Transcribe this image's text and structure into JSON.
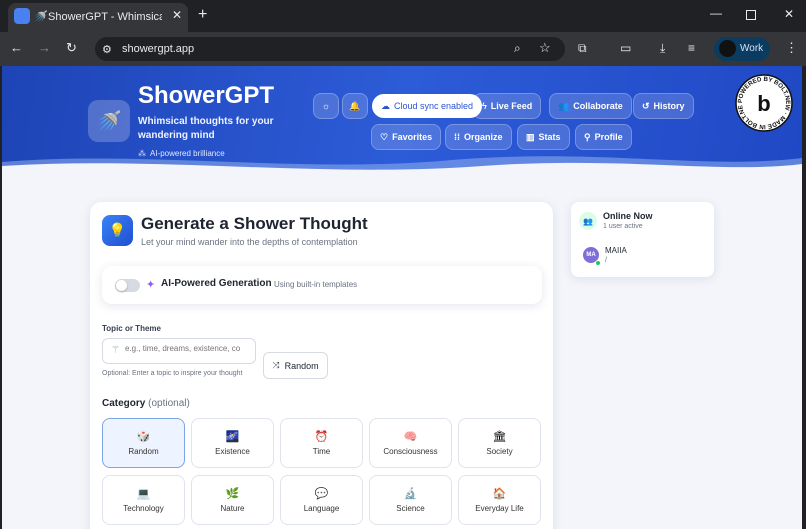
{
  "browser": {
    "tab_title": "ShowerGPT - Whimsical Sh",
    "url": "showergpt.app",
    "profile_label": "Work"
  },
  "header": {
    "app_name": "ShowerGPT",
    "tagline_line1": "Whimsical thoughts for your",
    "tagline_line2": "wandering mind",
    "badge": "AI-powered brilliance",
    "cloud_sync": "Cloud sync enabled",
    "nav": {
      "live_feed": "Live Feed",
      "collaborate": "Collaborate",
      "history": "History",
      "favorites": "Favorites",
      "organize": "Organize",
      "stats": "Stats",
      "profile": "Profile"
    },
    "bolt_badge_text": "POWERED BY BOLT.NEW · MADE IN BOLT.NEW ·"
  },
  "generator": {
    "title": "Generate a Shower Thought",
    "subtitle": "Let your mind wander into the depths of contemplation",
    "ai_label": "AI-Powered Generation",
    "ai_note": "Using built-in templates",
    "ai_enabled": false,
    "topic_label": "Topic or Theme",
    "topic_placeholder": "e.g., time, dreams, existence, co",
    "topic_hint": "Optional: Enter a topic to inspire your thought",
    "random_button": "Random",
    "category_label": "Category",
    "category_optional": "(optional)",
    "categories": [
      {
        "label": "Random",
        "icon": "🎲"
      },
      {
        "label": "Existence",
        "icon": "🌌"
      },
      {
        "label": "Time",
        "icon": "⏰"
      },
      {
        "label": "Consciousness",
        "icon": "🧠"
      },
      {
        "label": "Society",
        "icon": "🏛"
      },
      {
        "label": "Technology",
        "icon": "💻"
      },
      {
        "label": "Nature",
        "icon": "🌿"
      },
      {
        "label": "Language",
        "icon": "💬"
      },
      {
        "label": "Science",
        "icon": "🔬"
      },
      {
        "label": "Everyday Life",
        "icon": "🏠"
      }
    ],
    "selected_category": "Random"
  },
  "online": {
    "title": "Online Now",
    "count_text": "1 user active",
    "users": [
      {
        "initials": "MA",
        "name": "MAIIA",
        "sub": "/"
      }
    ]
  },
  "colors": {
    "accent": "#2d54d0",
    "header_blue": "#2048c5",
    "online_green": "#22c55e"
  }
}
